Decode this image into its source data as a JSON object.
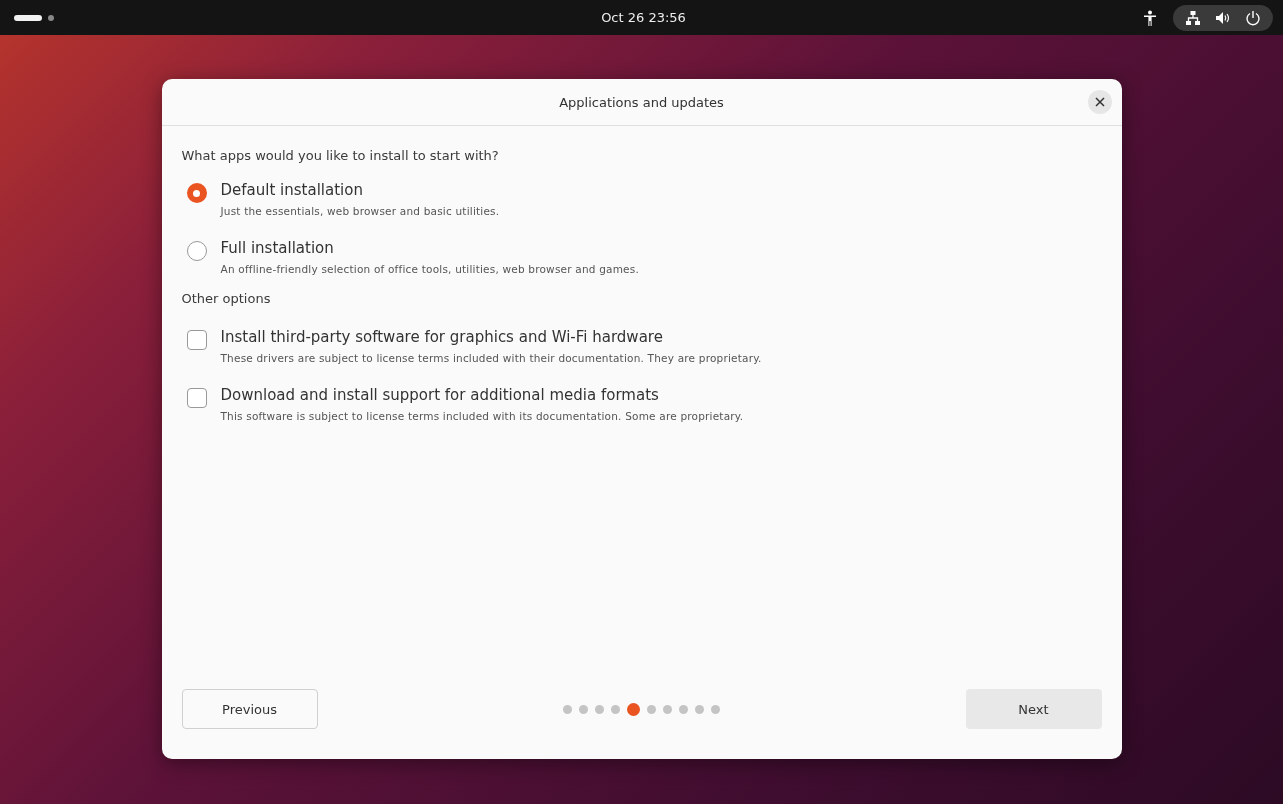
{
  "top_bar": {
    "workspaces": [
      {
        "selected": true
      },
      {
        "selected": false
      }
    ],
    "clock": "Oct 26  23:56"
  },
  "dialog": {
    "title": "Applications and updates",
    "question": "What apps would you like to install to start with?",
    "install_options": [
      {
        "label": "Default installation",
        "description": "Just the essentials, web browser and basic utilities.",
        "selected": true
      },
      {
        "label": "Full installation",
        "description": "An offline-friendly selection of office tools, utilities, web browser and games.",
        "selected": false
      }
    ],
    "other_heading": "Other options",
    "other_options": [
      {
        "label": "Install third-party software for graphics and Wi-Fi hardware",
        "description": "These drivers are subject to license terms included with their documentation. They are proprietary.",
        "checked": false
      },
      {
        "label": "Download and install support for additional media formats",
        "description": "This software is subject to license terms included with its documentation. Some are proprietary.",
        "checked": false
      }
    ],
    "previous_button": "Previous",
    "next_button": "Next",
    "steps": [
      {
        "selected": false
      },
      {
        "selected": false
      },
      {
        "selected": false
      },
      {
        "selected": false
      },
      {
        "selected": true
      },
      {
        "selected": false
      },
      {
        "selected": false
      },
      {
        "selected": false
      },
      {
        "selected": false
      },
      {
        "selected": false
      }
    ]
  }
}
